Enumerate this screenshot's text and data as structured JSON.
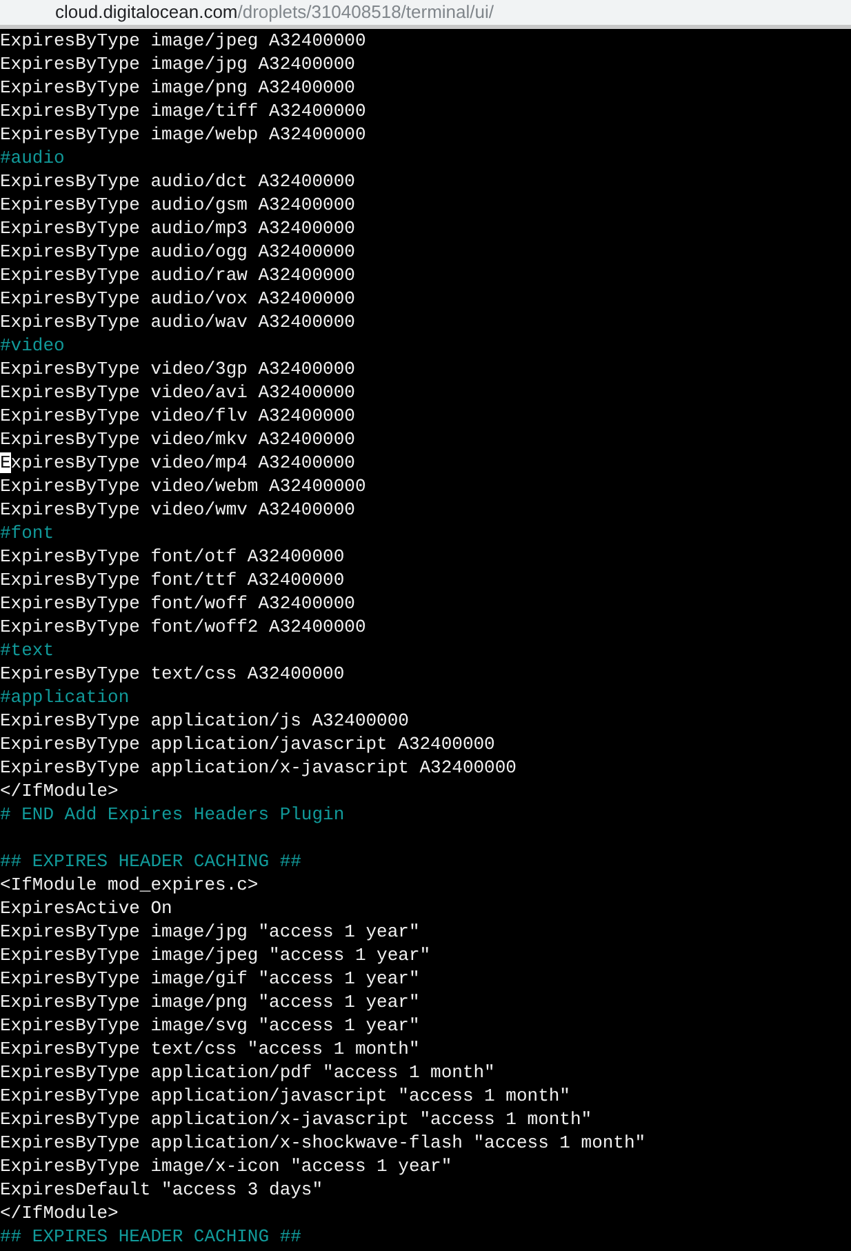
{
  "address_bar": {
    "domain": "cloud.digitalocean.com",
    "path": "/droplets/310408518/terminal/ui/"
  },
  "terminal": {
    "lines": [
      {
        "kind": "code",
        "text": "ExpiresByType image/jpeg A32400000"
      },
      {
        "kind": "code",
        "text": "ExpiresByType image/jpg A32400000"
      },
      {
        "kind": "code",
        "text": "ExpiresByType image/png A32400000"
      },
      {
        "kind": "code",
        "text": "ExpiresByType image/tiff A32400000"
      },
      {
        "kind": "code",
        "text": "ExpiresByType image/webp A32400000"
      },
      {
        "kind": "comment",
        "text": "#audio"
      },
      {
        "kind": "code",
        "text": "ExpiresByType audio/dct A32400000"
      },
      {
        "kind": "code",
        "text": "ExpiresByType audio/gsm A32400000"
      },
      {
        "kind": "code",
        "text": "ExpiresByType audio/mp3 A32400000"
      },
      {
        "kind": "code",
        "text": "ExpiresByType audio/ogg A32400000"
      },
      {
        "kind": "code",
        "text": "ExpiresByType audio/raw A32400000"
      },
      {
        "kind": "code",
        "text": "ExpiresByType audio/vox A32400000"
      },
      {
        "kind": "code",
        "text": "ExpiresByType audio/wav A32400000"
      },
      {
        "kind": "comment",
        "text": "#video"
      },
      {
        "kind": "code",
        "text": "ExpiresByType video/3gp A32400000"
      },
      {
        "kind": "code",
        "text": "ExpiresByType video/avi A32400000"
      },
      {
        "kind": "code",
        "text": "ExpiresByType video/flv A32400000"
      },
      {
        "kind": "code",
        "text": "ExpiresByType video/mkv A32400000"
      },
      {
        "kind": "code",
        "text": "ExpiresByType video/mp4 A32400000",
        "cursor": true
      },
      {
        "kind": "code",
        "text": "ExpiresByType video/webm A32400000"
      },
      {
        "kind": "code",
        "text": "ExpiresByType video/wmv A32400000"
      },
      {
        "kind": "comment",
        "text": "#font"
      },
      {
        "kind": "code",
        "text": "ExpiresByType font/otf A32400000"
      },
      {
        "kind": "code",
        "text": "ExpiresByType font/ttf A32400000"
      },
      {
        "kind": "code",
        "text": "ExpiresByType font/woff A32400000"
      },
      {
        "kind": "code",
        "text": "ExpiresByType font/woff2 A32400000"
      },
      {
        "kind": "comment",
        "text": "#text"
      },
      {
        "kind": "code",
        "text": "ExpiresByType text/css A32400000"
      },
      {
        "kind": "comment",
        "text": "#application"
      },
      {
        "kind": "code",
        "text": "ExpiresByType application/js A32400000"
      },
      {
        "kind": "code",
        "text": "ExpiresByType application/javascript A32400000"
      },
      {
        "kind": "code",
        "text": "ExpiresByType application/x-javascript A32400000"
      },
      {
        "kind": "code",
        "text": "</IfModule>"
      },
      {
        "kind": "comment",
        "text": "# END Add Expires Headers Plugin"
      },
      {
        "kind": "blank"
      },
      {
        "kind": "comment",
        "text": "## EXPIRES HEADER CACHING ##"
      },
      {
        "kind": "code",
        "text": "<IfModule mod_expires.c>"
      },
      {
        "kind": "code",
        "text": "ExpiresActive On"
      },
      {
        "kind": "code",
        "text": "ExpiresByType image/jpg \"access 1 year\""
      },
      {
        "kind": "code",
        "text": "ExpiresByType image/jpeg \"access 1 year\""
      },
      {
        "kind": "code",
        "text": "ExpiresByType image/gif \"access 1 year\""
      },
      {
        "kind": "code",
        "text": "ExpiresByType image/png \"access 1 year\""
      },
      {
        "kind": "code",
        "text": "ExpiresByType image/svg \"access 1 year\""
      },
      {
        "kind": "code",
        "text": "ExpiresByType text/css \"access 1 month\""
      },
      {
        "kind": "code",
        "text": "ExpiresByType application/pdf \"access 1 month\""
      },
      {
        "kind": "code",
        "text": "ExpiresByType application/javascript \"access 1 month\""
      },
      {
        "kind": "code",
        "text": "ExpiresByType application/x-javascript \"access 1 month\""
      },
      {
        "kind": "code",
        "text": "ExpiresByType application/x-shockwave-flash \"access 1 month\""
      },
      {
        "kind": "code",
        "text": "ExpiresByType image/x-icon \"access 1 year\""
      },
      {
        "kind": "code",
        "text": "ExpiresDefault \"access 3 days\""
      },
      {
        "kind": "code",
        "text": "</IfModule>"
      },
      {
        "kind": "comment",
        "text": "## EXPIRES HEADER CACHING ##"
      }
    ]
  }
}
